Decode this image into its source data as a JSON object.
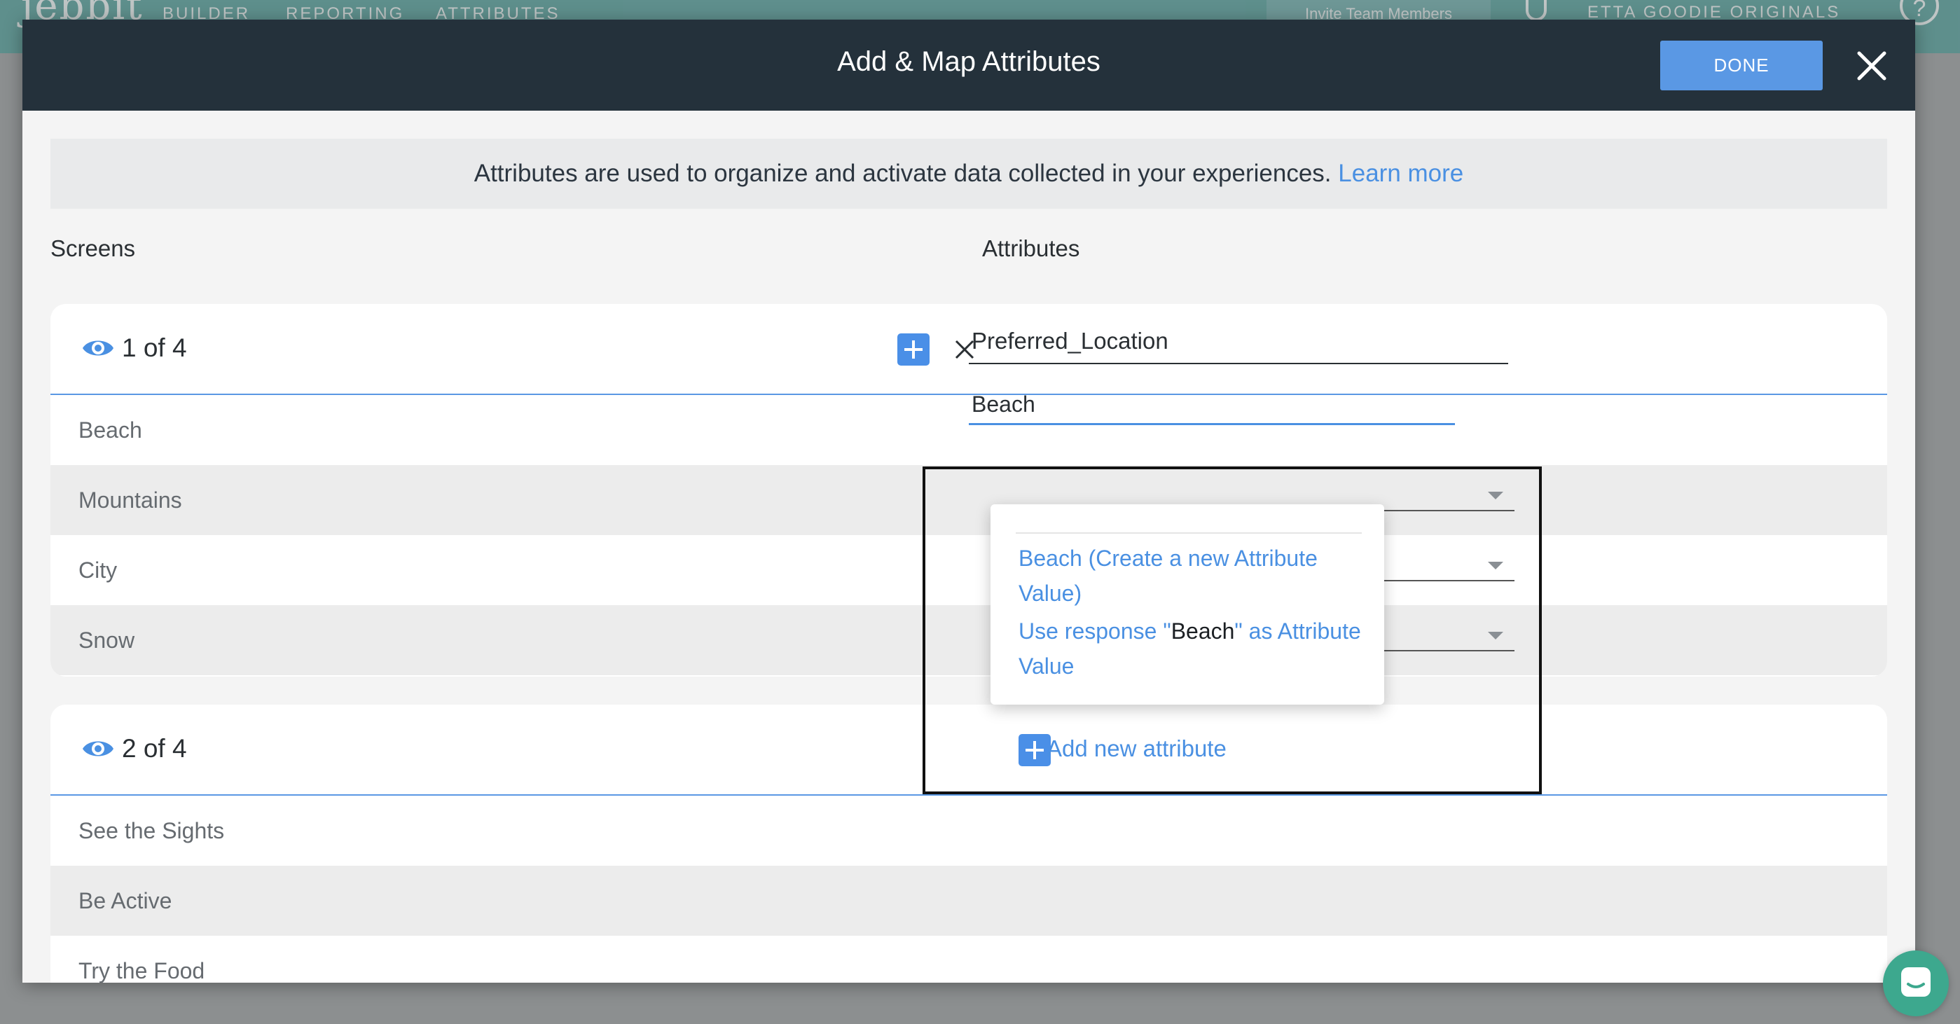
{
  "background_app": {
    "logo": "jebbit",
    "nav": [
      "BUILDER",
      "REPORTING",
      "ATTRIBUTES"
    ],
    "invite": "Invite Team Members",
    "account": "ETTA GOODIE ORIGINALS",
    "help": "?"
  },
  "modal": {
    "title": "Add & Map Attributes",
    "done_label": "DONE"
  },
  "info_banner": {
    "text": "Attributes are used to organize and activate data collected in your experiences.",
    "link": "Learn more"
  },
  "columns": {
    "screens": "Screens",
    "attributes": "Attributes"
  },
  "screens": [
    {
      "count": "1 of 4",
      "attribute_name": "Preferred_Location",
      "answers": [
        "Beach",
        "Mountains",
        "City",
        "Snow"
      ],
      "active_value_input": "Beach"
    },
    {
      "count": "2 of 4",
      "add_attribute_label": "Add new attribute",
      "answers": [
        "See the Sights",
        "Be Active",
        "Try the Food"
      ]
    }
  ],
  "dropdown": {
    "option1": "Beach (Create a new Attribute Value)",
    "option2_prefix": "Use response \"",
    "option2_highlight": "Beach",
    "option2_suffix": "\" as Attribute Value"
  },
  "colors": {
    "header": "#24313b",
    "accent": "#4a90e2",
    "done_button": "#5a98e4",
    "chat": "#3da88e"
  },
  "icons": [
    "eye-icon",
    "plus-icon",
    "close-icon",
    "chevron-down-icon",
    "chat-icon"
  ]
}
